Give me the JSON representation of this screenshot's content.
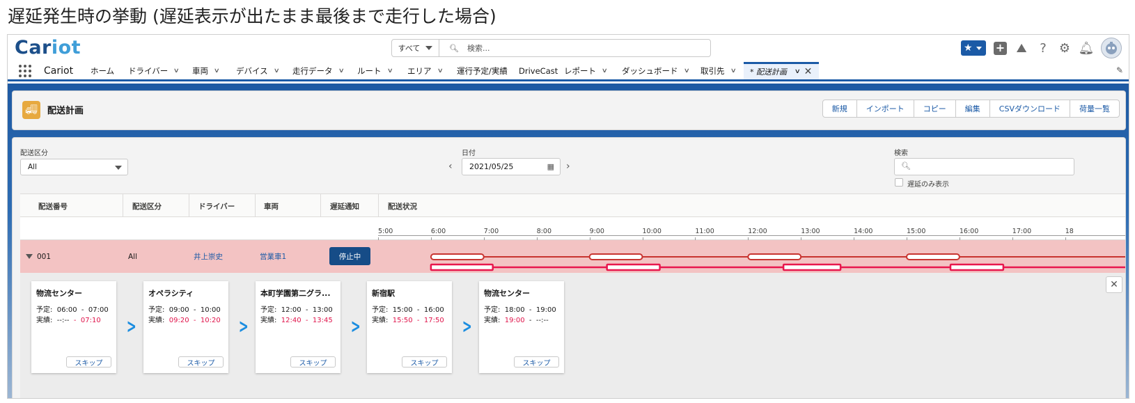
{
  "slide_title": "遅延発生時の挙動 (遅延表示が出たまま最後まで走行した場合)",
  "header": {
    "logo_main": "Car",
    "logo_accent": "iot",
    "search_scope": "すべて",
    "search_placeholder": "検索..."
  },
  "nav": {
    "app_name": "Cariot",
    "items": [
      {
        "label": "ホーム",
        "chevron": false
      },
      {
        "label": "ドライバー",
        "chevron": true
      },
      {
        "label": "車両",
        "chevron": true
      },
      {
        "label": "デバイス",
        "chevron": true
      },
      {
        "label": "走行データ",
        "chevron": true
      },
      {
        "label": "ルート",
        "chevron": true
      },
      {
        "label": "エリア",
        "chevron": true
      },
      {
        "label": "運行予定/実績",
        "chevron": false
      },
      {
        "label": "DriveCast",
        "chevron": false
      },
      {
        "label": "レポート",
        "chevron": true
      },
      {
        "label": "ダッシュボード",
        "chevron": true
      },
      {
        "label": "取引先",
        "chevron": true
      }
    ],
    "active_tab": "* 配送計画"
  },
  "page": {
    "title": "配送計画",
    "actions": [
      "新規",
      "インポート",
      "コピー",
      "編集",
      "CSVダウンロード",
      "荷量一覧"
    ]
  },
  "filters": {
    "category_label": "配送区分",
    "category_value": "All",
    "date_label": "日付",
    "date_value": "2021/05/25",
    "search_label": "検索",
    "delay_only_label": "遅延のみ表示"
  },
  "table": {
    "headers": [
      "配送番号",
      "配送区分",
      "ドライバー",
      "車両",
      "遅延通知",
      "配送状況"
    ],
    "time_ticks": [
      "5:00",
      "6:00",
      "7:00",
      "8:00",
      "9:00",
      "10:00",
      "11:00",
      "12:00",
      "13:00",
      "14:00",
      "15:00",
      "16:00",
      "17:00",
      "18"
    ],
    "row": {
      "number": "001",
      "category": "All",
      "driver": "井上崇史",
      "vehicle": "営業車1",
      "notify_button": "停止中"
    }
  },
  "gantt": {
    "axis_start_hour": 5,
    "planned": [
      [
        6.0,
        7.0
      ],
      [
        9.0,
        10.0
      ],
      [
        12.0,
        13.0
      ],
      [
        15.0,
        16.0
      ]
    ],
    "actual": [
      [
        6.0,
        7.17
      ],
      [
        9.33,
        10.33
      ],
      [
        12.67,
        13.75
      ],
      [
        15.83,
        16.83
      ]
    ],
    "planned_color": "#c8332f",
    "actual_color": "#e8174d"
  },
  "stops": [
    {
      "name": "物流センター",
      "plan_label": "予定:",
      "plan_from": "06:00",
      "plan_to": "07:00",
      "actual_label": "実績:",
      "actual_from": "--:--",
      "actual_to": "07:10",
      "from_red": false,
      "to_red": true,
      "skip": "スキップ"
    },
    {
      "name": "オペラシティ",
      "plan_label": "予定:",
      "plan_from": "09:00",
      "plan_to": "10:00",
      "actual_label": "実績:",
      "actual_from": "09:20",
      "actual_to": "10:20",
      "from_red": true,
      "to_red": true,
      "skip": "スキップ"
    },
    {
      "name": "本町学園第二グラ...",
      "plan_label": "予定:",
      "plan_from": "12:00",
      "plan_to": "13:00",
      "actual_label": "実績:",
      "actual_from": "12:40",
      "actual_to": "13:45",
      "from_red": true,
      "to_red": true,
      "skip": "スキップ"
    },
    {
      "name": "新宿駅",
      "plan_label": "予定:",
      "plan_from": "15:00",
      "plan_to": "16:00",
      "actual_label": "実績:",
      "actual_from": "15:50",
      "actual_to": "17:50",
      "from_red": true,
      "to_red": true,
      "skip": "スキップ"
    },
    {
      "name": "物流センター",
      "plan_label": "予定:",
      "plan_from": "18:00",
      "plan_to": "19:00",
      "actual_label": "実績:",
      "actual_from": "19:00",
      "actual_to": "--:--",
      "from_red": true,
      "to_red": false,
      "skip": "スキップ"
    }
  ]
}
